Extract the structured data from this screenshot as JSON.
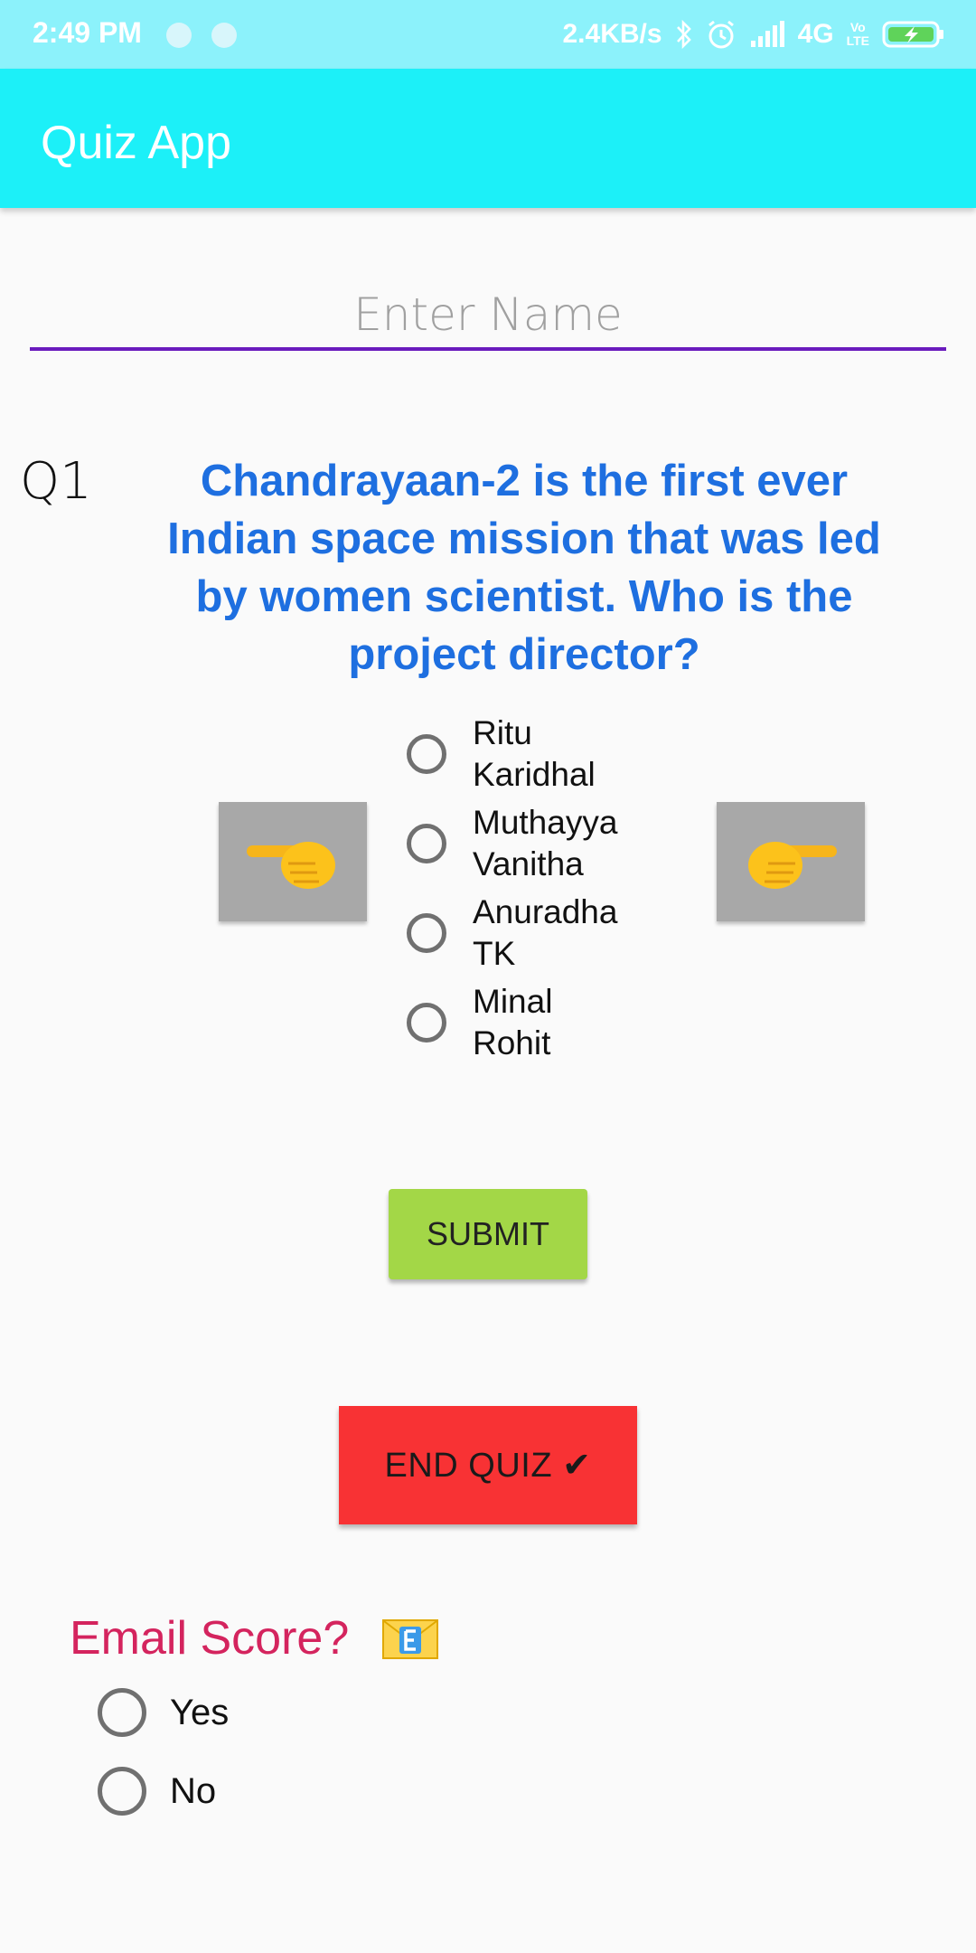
{
  "status_bar": {
    "time": "2:49 PM",
    "network_speed": "2.4KB/s",
    "network_type": "4G",
    "lte_top": "Vo",
    "lte_bottom": "LTE"
  },
  "app_bar": {
    "title": "Quiz App"
  },
  "name_field": {
    "placeholder": "Enter Name",
    "value": ""
  },
  "question": {
    "number": "Q1",
    "text": "Chandrayaan-2 is the first ever Indian space mission that was led by women scientist. Who is the project director?"
  },
  "options": [
    {
      "line1": "Ritu",
      "line2": "Karidhal",
      "selected": false
    },
    {
      "line1": "Muthayya",
      "line2": "Vanitha",
      "selected": false
    },
    {
      "line1": "Anuradha",
      "line2": "TK",
      "selected": false
    },
    {
      "line1": "Minal",
      "line2": "Rohit",
      "selected": false
    }
  ],
  "nav": {
    "prev_icon": "pointing-left-hand-icon",
    "next_icon": "pointing-right-hand-icon"
  },
  "buttons": {
    "submit": "SUBMIT",
    "end_quiz": "END QUIZ ✔"
  },
  "email_section": {
    "title": "Email Score?",
    "icon": "envelope-e-icon",
    "options": [
      {
        "label": "Yes",
        "selected": false
      },
      {
        "label": "No",
        "selected": false
      }
    ]
  },
  "colors": {
    "status_bar": "#8cf2fb",
    "app_bar": "#1cf0f8",
    "question_text": "#1e6fe0",
    "input_underline": "#6a1bbd",
    "submit": "#a3d747",
    "end_quiz": "#f83234",
    "email_title": "#d4245e",
    "arrow_button": "#a8a8a8"
  }
}
